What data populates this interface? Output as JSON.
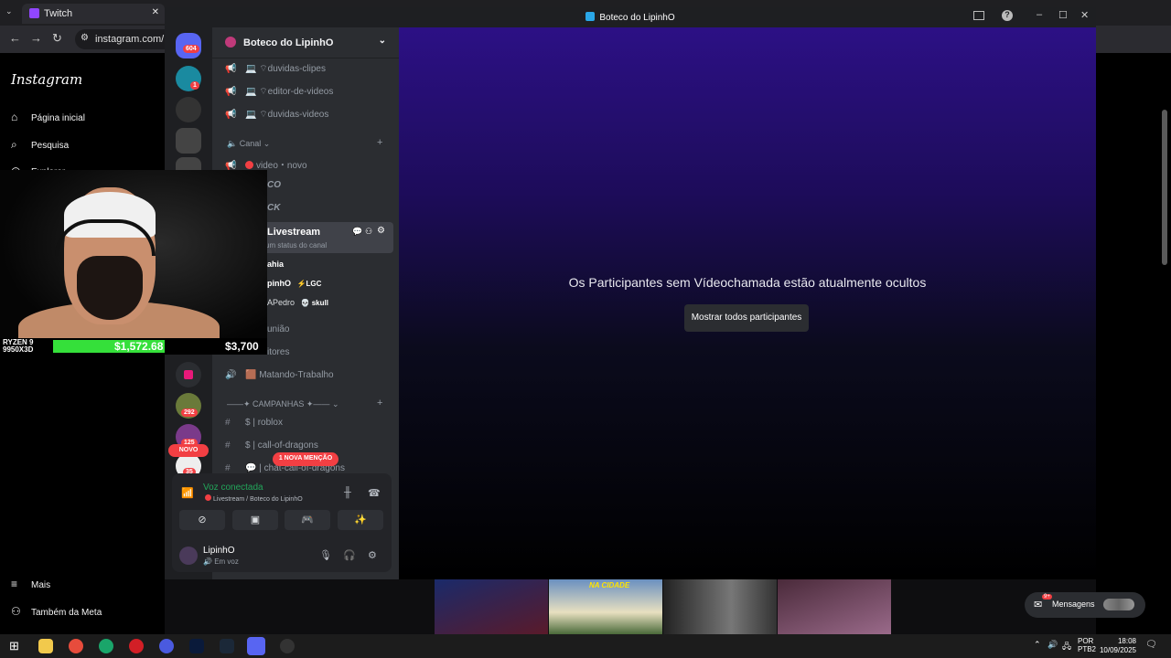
{
  "browser": {
    "tab_title": "Twitch",
    "url": "instagram.com/lip"
  },
  "instagram": {
    "logo": "Instagram",
    "nav": [
      {
        "label": "Página inicial",
        "icon": "home-icon"
      },
      {
        "label": "Pesquisa",
        "icon": "search-icon"
      },
      {
        "label": "Explorar",
        "icon": "explore-icon"
      }
    ],
    "more": "Mais",
    "meta": "Também da Meta"
  },
  "webcam": {
    "cpu_label": "RYZEN 9\n9950X3D",
    "value_left": "$1,572.68",
    "value_right": "$3,700"
  },
  "discord": {
    "window_title": "Boteco do LipinhO",
    "server_name": "Boteco do LipinhO",
    "servers": [
      {
        "name": "discord-home",
        "badge": "604"
      },
      {
        "name": "server-1",
        "badge": "1"
      },
      {
        "name": "server-legacy",
        "badge": ""
      },
      {
        "name": "server-lgc",
        "badge": ""
      },
      {
        "name": "server-lgc-2",
        "badge": ""
      },
      {
        "name": "server-pink",
        "badge": ""
      },
      {
        "name": "server-a",
        "badge": "292"
      },
      {
        "name": "server-b",
        "badge": "125"
      },
      {
        "name": "server-c",
        "badge": "35"
      }
    ],
    "new_label": "NOVO",
    "mention_label": "1 NOVA MENÇÃO",
    "channels_top": [
      {
        "label": "💻 ⌔duvidas-clipes"
      },
      {
        "label": "💻 ⌔editor-de-videos"
      },
      {
        "label": "💻 ⌔duvidas-videos"
      }
    ],
    "category_canal": "Canal",
    "channel_video": "video・novo",
    "channel_co": "CO",
    "channel_ck": "CK",
    "livestream": "Livestream",
    "livestream_status": "um status do canal",
    "voice_users": [
      {
        "name": "ahia",
        "tag": ""
      },
      {
        "name": "pinhO",
        "tag": "⚡LGC"
      },
      {
        "name": "APedro",
        "tag": "💀 skull"
      }
    ],
    "channel_reuniao": "união",
    "channel_editores": "itores",
    "channel_matando": "🟫 Matando-Trabalho",
    "category_campanhas": "——✦ CAMPANHAS ✦——",
    "text_channels": [
      {
        "prefix": "#",
        "label": "$ | roblox"
      },
      {
        "prefix": "#",
        "label": "$ | call-of-dragons"
      },
      {
        "prefix": "#",
        "label": "💬 | chat-call-of-dragons"
      }
    ],
    "voice_connected": "Voz conectada",
    "voice_location": "Livestream / Boteco do LipinhO",
    "user_name": "LipinhO",
    "user_status": "Em voz",
    "stage_message": "Os Participantes sem Vídeochamada estão atualmente ocultos",
    "show_button": "Mostrar todos participantes",
    "thumb_text": "NA CIDADE",
    "messages_label": "Mensagens",
    "messages_badge": "9+"
  },
  "taskbar": {
    "lang": "POR",
    "layout": "PTB2",
    "time": "18:08",
    "date": "10/09/2025"
  },
  "colors": {
    "discord_bg": "#2b2d31",
    "discord_dark": "#1e1f22",
    "green": "#35e03a",
    "red": "#f23f43",
    "stage_purple": "#2c1085"
  }
}
